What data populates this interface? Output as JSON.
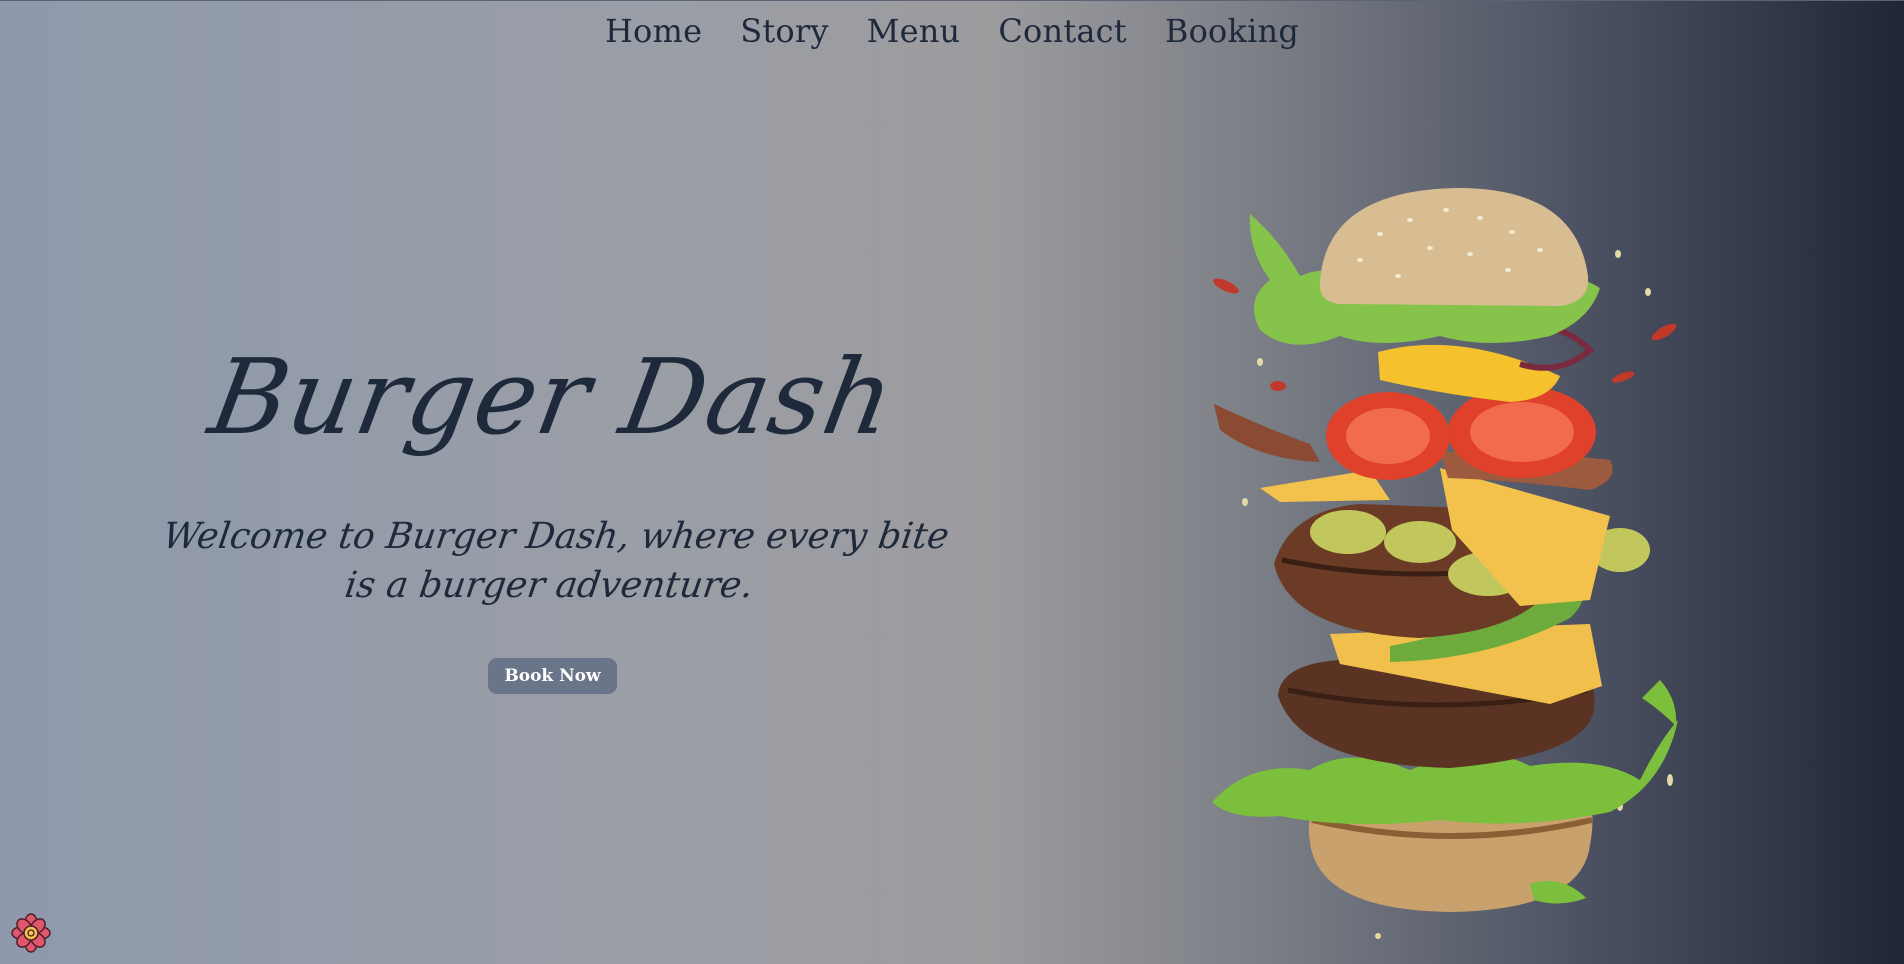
{
  "nav": {
    "items": [
      {
        "label": "Home"
      },
      {
        "label": "Story"
      },
      {
        "label": "Menu"
      },
      {
        "label": "Contact"
      },
      {
        "label": "Booking"
      }
    ]
  },
  "hero": {
    "title": "Burger Dash",
    "subtitle": "Welcome to Burger Dash, where every bite is a burger adventure.",
    "cta_label": "Book Now"
  },
  "images": {
    "burger": "flying-burger-ingredients-image",
    "corner_icon": "react-flower-icon"
  },
  "colors": {
    "text": "#1e293b",
    "button_bg": "#6b7589",
    "button_text": "#ffffff",
    "gradient_start": "#8e99ac",
    "gradient_end": "#1f2637"
  }
}
